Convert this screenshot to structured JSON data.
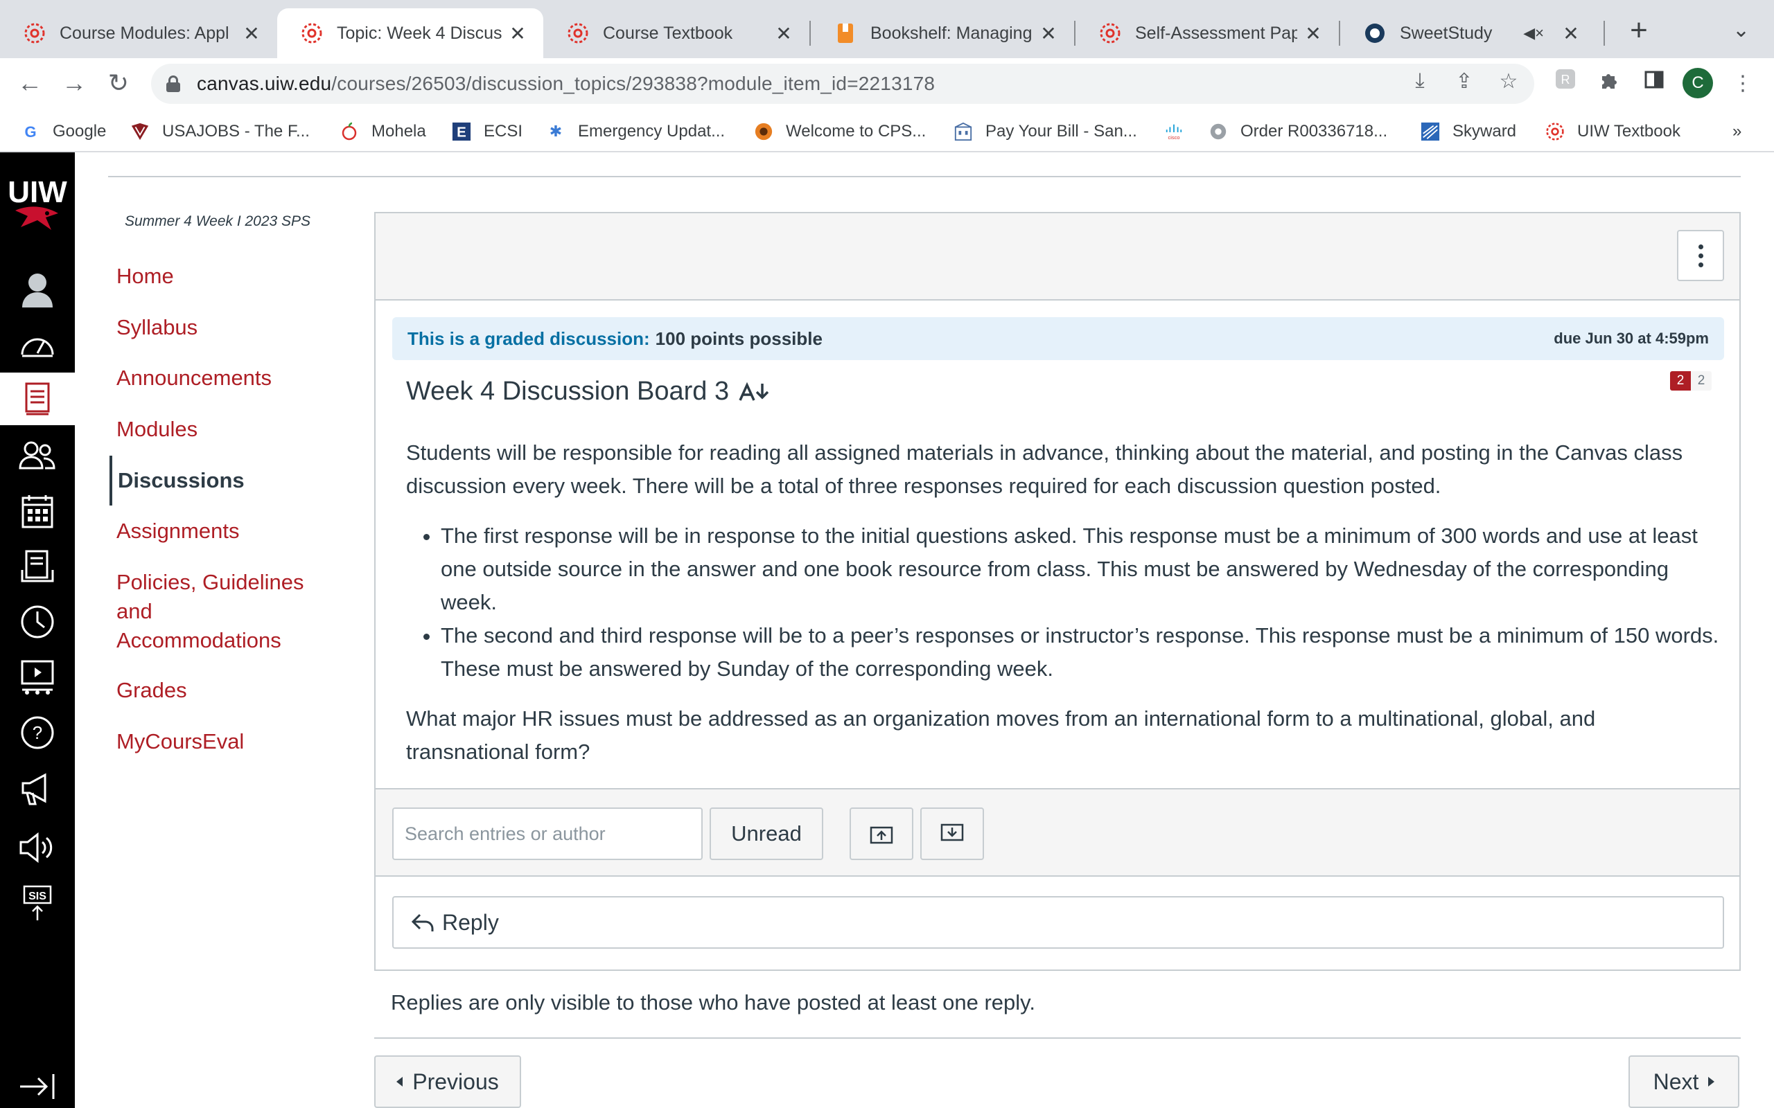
{
  "browser": {
    "tabs": [
      {
        "title": "Course Modules: Appl",
        "icon": "canvas-icon"
      },
      {
        "title": "Topic: Week 4 Discuss",
        "icon": "canvas-icon",
        "active": true
      },
      {
        "title": "Course Textbook",
        "icon": "canvas-icon"
      },
      {
        "title": "Bookshelf: Managing H",
        "icon": "bookshelf-icon"
      },
      {
        "title": "Self-Assessment Pape",
        "icon": "canvas-icon"
      },
      {
        "title": "SweetStudy",
        "icon": "sweetstudy-icon",
        "muted": true
      }
    ],
    "url_host": "canvas.uiw.edu",
    "url_path": "/courses/26503/discussion_topics/293838?module_item_id=2213178",
    "profile_initial": "C",
    "bookmarks": [
      {
        "label": "Google"
      },
      {
        "label": "USAJOBS - The F..."
      },
      {
        "label": "Mohela"
      },
      {
        "label": "ECSI"
      },
      {
        "label": "Emergency Updat..."
      },
      {
        "label": "Welcome to CPS..."
      },
      {
        "label": "Pay Your Bill - San..."
      },
      {
        "label": "Order R00336718..."
      },
      {
        "label": "Skyward"
      },
      {
        "label": "UIW Textbook"
      }
    ],
    "bookmarks_more": "»"
  },
  "global_nav": {
    "logo": "UIW",
    "items": [
      "account-icon",
      "dashboard-icon",
      "courses-icon",
      "groups-icon",
      "calendar-icon",
      "inbox-icon",
      "history-icon",
      "commons-icon",
      "help-icon",
      "announcements-icon",
      "audio-icon",
      "sis-icon"
    ],
    "sis_label": "SIS",
    "collapse": "collapse-icon"
  },
  "course_nav": {
    "term": "Summer 4 Week I 2023 SPS",
    "items": [
      {
        "label": "Home"
      },
      {
        "label": "Syllabus"
      },
      {
        "label": "Announcements"
      },
      {
        "label": "Modules"
      },
      {
        "label": "Discussions",
        "active": true
      },
      {
        "label": "Assignments"
      },
      {
        "label": "Policies, Guidelines and Accommodations"
      },
      {
        "label": "Grades"
      },
      {
        "label": "MyCoursEval"
      }
    ]
  },
  "discussion": {
    "graded_lead": "This is a graded discussion:",
    "points": "100 points possible",
    "due": "due Jun 30 at 4:59pm",
    "title": "Week 4 Discussion Board 3",
    "unread_count": "2",
    "total_count": "2",
    "intro": "Students will be responsible for reading all assigned materials in advance, thinking about the material, and posting in the Canvas class discussion every week. There will be a total of three responses required for each discussion question posted.",
    "bullets": [
      "The first response will be in response to the initial questions asked. This response must be a minimum of 300 words and use at least one outside source in the answer and one book resource from class. This must be answered by Wednesday of the corresponding week.",
      "The second and third response will be to a peer’s responses or instructor’s response. This response must be a minimum of 150 words. These must be answered by Sunday of the corresponding week."
    ],
    "question": "What major HR issues must be addressed as an organization moves from an international form to a multinational, global, and transnational form?",
    "search_placeholder": "Search entries or author",
    "unread_button": "Unread",
    "reply_label": "Reply",
    "note": "Replies are only visible to those who have posted at least one reply."
  },
  "pager": {
    "previous": "Previous",
    "next": "Next"
  },
  "colors": {
    "canvas_red": "#ae1e25",
    "link_blue": "#0770a3",
    "graded_bg": "#e5f1fa",
    "nav_black": "#000000"
  }
}
